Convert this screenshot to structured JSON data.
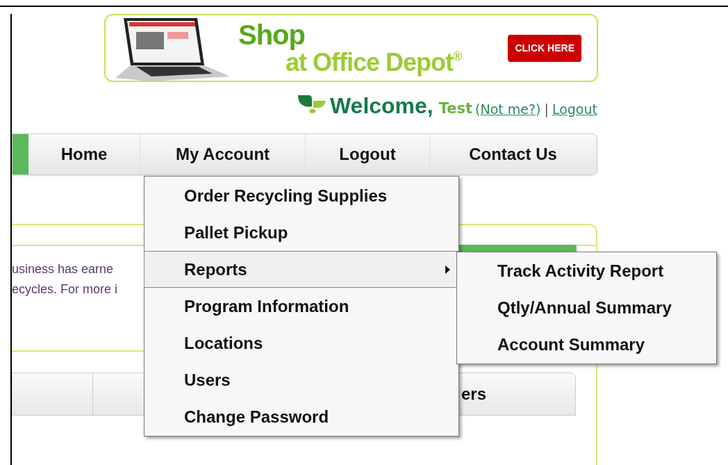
{
  "banner": {
    "headline": "Shop",
    "subline": "at Office Depot",
    "mark": "®",
    "button": "CLICK HERE"
  },
  "welcome": {
    "greeting": "Welcome,",
    "user": "Test",
    "open": "(",
    "not_me": "Not me?",
    "close": ")",
    "separator": "|",
    "logout": "Logout"
  },
  "nav": [
    {
      "label": "Home"
    },
    {
      "label": "My Account"
    },
    {
      "label": "Logout"
    },
    {
      "label": "Contact Us"
    }
  ],
  "menu": [
    {
      "label": "Order Recycling Supplies",
      "selected": false
    },
    {
      "label": "Pallet Pickup",
      "selected": false
    },
    {
      "label": "Reports",
      "selected": true,
      "children": [
        {
          "label": "Track Activity Report"
        },
        {
          "label": "Qtly/Annual Summary"
        },
        {
          "label": "Account Summary"
        }
      ]
    },
    {
      "label": "Program Information",
      "selected": false
    },
    {
      "label": "Locations",
      "selected": false
    },
    {
      "label": "Users",
      "selected": false
    },
    {
      "label": "Change Password",
      "selected": false
    }
  ],
  "panel": {
    "lines": [
      "usiness has earne",
      "ecycles. For more i"
    ],
    "tab_label": "ers"
  }
}
